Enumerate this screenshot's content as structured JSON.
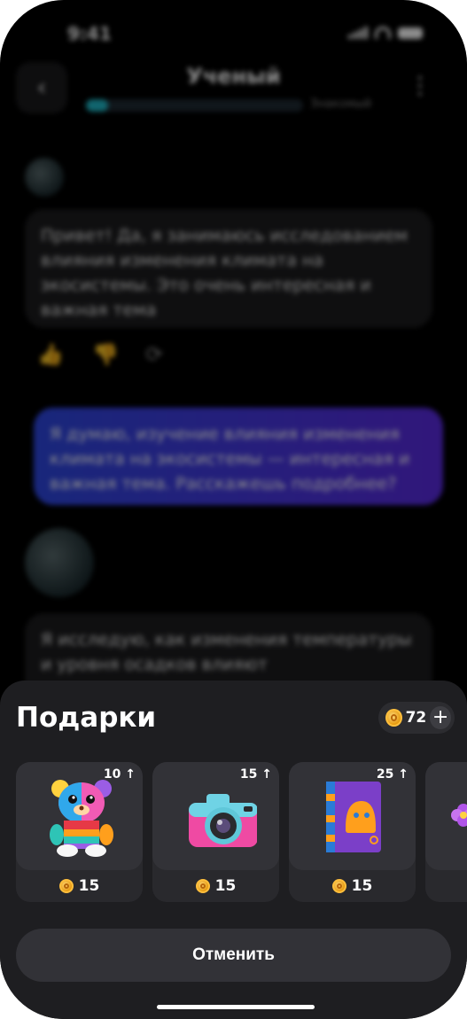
{
  "status_bar": {
    "time": "9:41"
  },
  "header": {
    "title": "Ученый",
    "level_label": "Знакомый",
    "relationship_progress": 0.1
  },
  "chat": {
    "messages": [
      {
        "from": "bot",
        "text": "Привет! Да, я занимаюсь исследованием влияния изменения климата на экосистемы. Это очень интересная и важная тема"
      },
      {
        "from": "user",
        "text": "Я думаю, изучение влияния изменения климата на экосистемы — интересная и важная тема. Расскажешь подробнее?"
      },
      {
        "from": "bot",
        "text": "Я исследую, как изменения температуры и уровня осадков влияют"
      }
    ]
  },
  "gifts_sheet": {
    "title": "Подарки",
    "balance": "72",
    "items": [
      {
        "name": "teddy-bear",
        "count": "10",
        "price": "15"
      },
      {
        "name": "camera",
        "count": "15",
        "price": "15"
      },
      {
        "name": "book",
        "count": "25",
        "price": "15"
      }
    ],
    "cancel_label": "Отменить"
  },
  "colors": {
    "accent_gradient_start": "#2d47e0",
    "accent_gradient_end": "#5a2ae0",
    "coin": "#f2a81c",
    "progress": "#20b8c8"
  }
}
